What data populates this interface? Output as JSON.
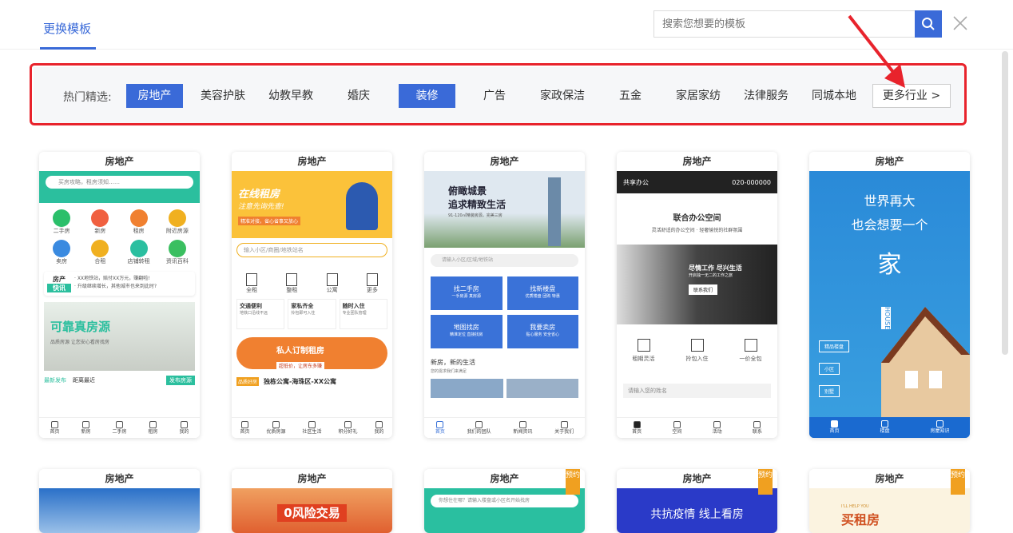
{
  "header": {
    "tab_label": "更换模板",
    "search_placeholder": "搜索您想要的模板"
  },
  "filter": {
    "label": "热门精选:",
    "categories": [
      {
        "label": "房地产",
        "active": true
      },
      {
        "label": "美容护肤",
        "active": false
      },
      {
        "label": "幼教早教",
        "active": false
      },
      {
        "label": "婚庆",
        "active": false
      },
      {
        "label": "装修",
        "active": true
      },
      {
        "label": "广告",
        "active": false
      },
      {
        "label": "家政保洁",
        "active": false
      },
      {
        "label": "五金",
        "active": false
      },
      {
        "label": "家居家纺",
        "active": false
      },
      {
        "label": "法律服务",
        "active": false
      },
      {
        "label": "同城本地",
        "active": false
      }
    ],
    "more_label": "更多行业 >"
  },
  "colors": {
    "accent": "#3a6ad8",
    "highlight_border": "#e8232c",
    "badge": "#f0a020"
  },
  "cards": {
    "c1": {
      "title": "房地产",
      "search": "买房攻略，租房须知……",
      "icons": [
        "二手房",
        "新房",
        "租房",
        "附近房源",
        "卖房",
        "合租",
        "店铺转租",
        "资讯百科"
      ],
      "news_logo1": "房产",
      "news_logo2": "快讯",
      "news1": "· XX地铁站，赔付XX万元，赚翻啦!",
      "news2": "· 升级继续增长，其他城市也来到此时?",
      "banner": "可靠真房源",
      "banner_sub": "品质房源 让您安心看房找房",
      "bottom_left1": "最新发布",
      "bottom_left2": "距离最近",
      "bottom_btn": "发布房源",
      "nav": [
        "首页",
        "新房",
        "二手房",
        "租房",
        "我的"
      ]
    },
    "c2": {
      "title": "房地产",
      "banner1": "在线租房",
      "banner2": "注意先询先查!",
      "banner3": "精准对接，省心省事又放心",
      "search": "输入小区/商圈/地铁站名",
      "icons": [
        "全租",
        "整租",
        "公寓",
        "更多"
      ],
      "f1t": "交通便利",
      "f1s": "地铁口沿线不远",
      "f2t": "家私齐全",
      "f2s": "拎包即可入住",
      "f3t": "随时入住",
      "f3s": "专业团队管理",
      "promo": "私人订制租房",
      "promo_sub": "超低价，让房东多赚",
      "listing_tag": "品质好房",
      "listing": "独栋公寓-海珠区-XX公寓",
      "nav": [
        "首页",
        "优质房源",
        "社区生活",
        "积分好礼",
        "我的"
      ]
    },
    "c3": {
      "title": "房地产",
      "hero1": "俯瞰城景",
      "hero2": "追求精致生活",
      "hero3": "91-120㎡精装房源，完美三房",
      "search": "请输入小区/区域/地铁站",
      "b1t": "找二手房",
      "b1s": "一手房源 真房源",
      "b2t": "找新楼盘",
      "b2s": "优质楼盘 团购 特惠",
      "b3t": "地图找房",
      "b3s": "精准定位 直接找房",
      "b4t": "我要卖房",
      "b4s": "贴心服务 安全省心",
      "sect": "新房，新的生活",
      "sects": "您的需求我们来满足",
      "nav": [
        "首页",
        "我们的团队",
        "新闻资讯",
        "关于我们"
      ]
    },
    "c4": {
      "title": "房地产",
      "brand": "共享办公",
      "phone": "020-000000",
      "h1": "联合办公空间",
      "h2": "灵活舒适的办公空间 · 轻奢愉悦的社群氛围",
      "ov1": "尽情工作 尽兴生活",
      "ov2": "开启独一无二的工作之旅",
      "ovbtn": "联系我们",
      "icons": [
        "租期灵活",
        "拎包入住",
        "一价全包"
      ],
      "input": "请输入您的姓名",
      "nav": [
        "首页",
        "空间",
        "活动",
        "联系"
      ]
    },
    "c5": {
      "title": "房地产",
      "l1": "世界再大",
      "l2": "也会想要一个",
      "big": "家",
      "vert": "HOUSE",
      "b1": "精品楼盘",
      "b2": "小区",
      "b3": "别墅",
      "nav": [
        "首页",
        "楼盘",
        "房屋知识"
      ]
    },
    "row2": [
      {
        "title": "房地产"
      },
      {
        "title": "房地产",
        "text": "0风险交易"
      },
      {
        "title": "房地产",
        "badge": "预约",
        "search": "你想住在哪？请输入楼盘或小区名开始找房"
      },
      {
        "title": "房地产",
        "badge": "预约",
        "text": "共抗疫情 线上看房"
      },
      {
        "title": "房地产",
        "badge": "预约",
        "text1": "I'LL HELP YOU",
        "text2": "买租房"
      }
    ]
  }
}
